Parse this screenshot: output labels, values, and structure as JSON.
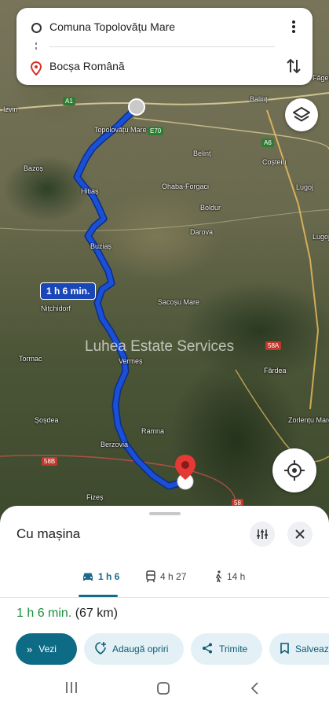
{
  "search": {
    "origin": "Comuna Topolovățu Mare",
    "destination": "Bocșa Română"
  },
  "map": {
    "places": [
      "Izvin",
      "Topolovățu Mare",
      "Balinț",
      "Bazoș",
      "Belinț",
      "Coșteiu",
      "Hitiaș",
      "Ohaba-Forgaci",
      "Boldur",
      "Lugoj",
      "Buziaș",
      "Darova",
      "Nițchidorf",
      "Sacoșu Mare",
      "Tormac",
      "Vermeș",
      "Fârdea",
      "Zorlențu Mare",
      "Șoșdea",
      "Ramna",
      "Berzovia",
      "Fizeș",
      "Lugoj",
      "Făget"
    ],
    "road_badges": [
      "A1",
      "E70",
      "A6",
      "58A",
      "58B",
      "58"
    ],
    "watermark": "Luhea Estate Services",
    "duration_label": "1 h 6 min.",
    "route_color": "#1a4fd6"
  },
  "sheet": {
    "title": "Cu mașina",
    "modes": [
      {
        "icon": "car-icon",
        "label": "1 h 6"
      },
      {
        "icon": "train-icon",
        "label": "4 h 27"
      },
      {
        "icon": "walk-icon",
        "label": "14 h"
      }
    ],
    "summary_time": "1 h 6 min.",
    "summary_distance": "(67 km)",
    "actions": {
      "start": "Vezi",
      "add_stops": "Adaugă opriri",
      "share": "Trimite",
      "save": "Salvează"
    }
  },
  "colors": {
    "accent": "#0e6b85",
    "summary_time": "#1e8e3e",
    "pin": "#e53935"
  }
}
